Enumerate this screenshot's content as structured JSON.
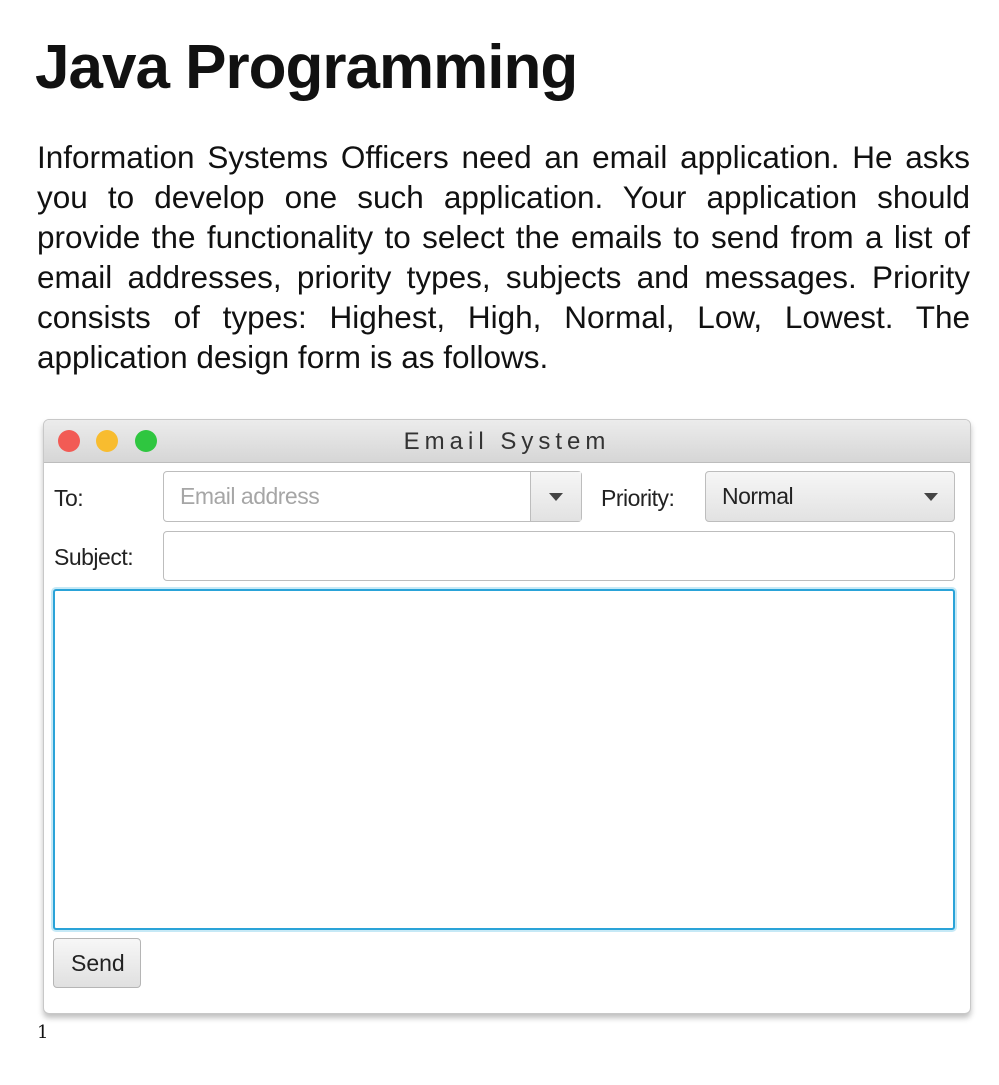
{
  "heading": "Java Programming",
  "paragraph": "Information Systems Officers need an email application. He asks you to develop one such application. Your application should provide the functionality to select the emails to send from a list of email addresses, priority types, subjects and messages. Priority consists of types: Highest, High, Normal, Low, Lowest. The application design form is as follows.",
  "window": {
    "title": "Email System",
    "controls": {
      "close_color": "#f25b55",
      "minimize_color": "#f8bc2f",
      "maximize_color": "#2fc640"
    },
    "to_label": "To:",
    "to_placeholder": "Email address",
    "priority_label": "Priority:",
    "priority_value": "Normal",
    "subject_label": "Subject:",
    "subject_value": "",
    "message_value": "",
    "focus_color": "#2aa3d8",
    "send_label": "Send"
  },
  "page_number": "1"
}
